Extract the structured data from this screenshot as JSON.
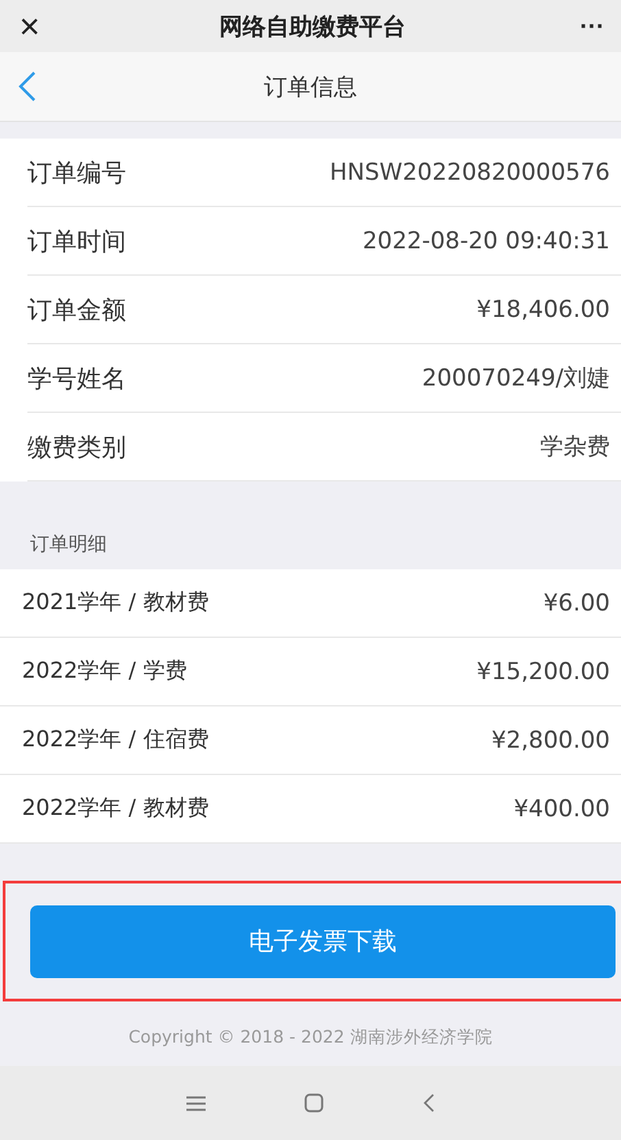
{
  "app_bar": {
    "close": "×",
    "title": "网络自助缴费平台",
    "more": "···"
  },
  "nav_bar": {
    "title": "订单信息"
  },
  "order_info": [
    {
      "label": "订单编号",
      "value": "HNSW20220820000576"
    },
    {
      "label": "订单时间",
      "value": "2022-08-20 09:40:31"
    },
    {
      "label": "订单金额",
      "value": "¥18,406.00"
    },
    {
      "label": "学号姓名",
      "value": "200070249/刘婕"
    },
    {
      "label": "缴费类别",
      "value": "学杂费"
    }
  ],
  "details": {
    "heading": "订单明细",
    "rows": [
      {
        "label": "2021学年 / 教材费",
        "value": "¥6.00"
      },
      {
        "label": "2022学年 / 学费",
        "value": "¥15,200.00"
      },
      {
        "label": "2022学年 / 住宿费",
        "value": "¥2,800.00"
      },
      {
        "label": "2022学年 / 教材费",
        "value": "¥400.00"
      }
    ]
  },
  "download_button": "电子发票下载",
  "footer": "Copyright © 2018 - 2022 湖南涉外经济学院"
}
